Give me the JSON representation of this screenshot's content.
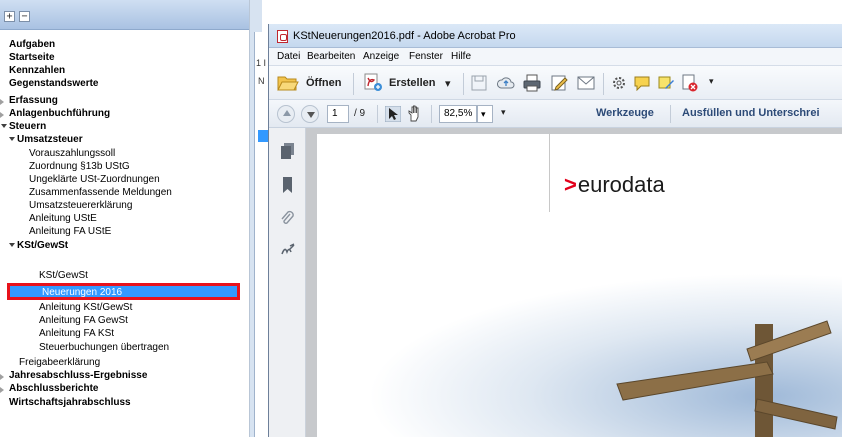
{
  "tree": {
    "toolbar": {
      "expand_symbol": "+",
      "collapse_symbol": "−"
    },
    "items": [
      {
        "label": "Aufgaben"
      },
      {
        "label": "Startseite"
      },
      {
        "label": "Kennzahlen"
      },
      {
        "label": "Gegenstandswerte"
      },
      {
        "label": "Erfassung"
      },
      {
        "label": "Anlagenbuchführung"
      },
      {
        "label": "Steuern"
      },
      {
        "label": "Umsatzsteuer"
      },
      {
        "label": "Vorauszahlungssoll"
      },
      {
        "label": "Zuordnung §13b UStG"
      },
      {
        "label": "Ungeklärte USt-Zuordnungen"
      },
      {
        "label": "Zusammenfassende Meldungen"
      },
      {
        "label": "Umsatzsteuererklärung"
      },
      {
        "label": "Anleitung UStE"
      },
      {
        "label": "Anleitung FA UStE"
      },
      {
        "label": "KSt/GewSt"
      },
      {
        "label": "KSt/GewSt"
      },
      {
        "label": "Neuerungen 2016"
      },
      {
        "label": "Anleitung KSt/GewSt"
      },
      {
        "label": "Anleitung FA GewSt"
      },
      {
        "label": "Anleitung FA KSt"
      },
      {
        "label": "Steuerbuchungen übertragen"
      },
      {
        "label": "Freigabeerklärung"
      },
      {
        "label": "Jahresabschluss-Ergebnisse"
      },
      {
        "label": "Abschlussberichte"
      },
      {
        "label": "Wirtschaftsjahrabschluss"
      }
    ]
  },
  "middle": {
    "row1": "1 I",
    "row2": "N"
  },
  "acrobat": {
    "title": "KStNeuerungen2016.pdf - Adobe Acrobat Pro",
    "menu": [
      "Datei",
      "Bearbeiten",
      "Anzeige",
      "Fenster",
      "Hilfe"
    ],
    "toolbar": {
      "open_label": "Öffnen",
      "create_label": "Erstellen",
      "create_dropdown": "▾",
      "more": "▾"
    },
    "nav": {
      "page_current": "1",
      "page_total": "/ 9",
      "zoom": "82,5%",
      "zoom_dropdown": "▾",
      "more": "▾",
      "tools_label": "Werkzeuge",
      "fill_sign_label": "Ausfüllen und Unterschrei"
    },
    "document": {
      "logo_chevron": ">",
      "logo_text": "eurodata"
    },
    "colors": {
      "logo_red": "#e2001a",
      "selection": "#3399ff",
      "highlight_border": "#e8121b"
    }
  }
}
